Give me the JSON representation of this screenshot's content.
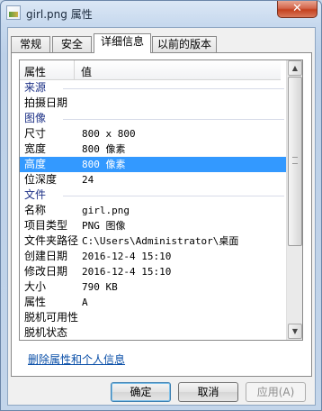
{
  "window": {
    "title": "girl.png 属性",
    "close_glyph": "✕"
  },
  "tabs": [
    {
      "label": "常规"
    },
    {
      "label": "安全"
    },
    {
      "label": "详细信息"
    },
    {
      "label": "以前的版本"
    }
  ],
  "columns": {
    "property": "属性",
    "value": "值"
  },
  "properties": [
    {
      "type": "group",
      "key": "来源",
      "value": ""
    },
    {
      "type": "item",
      "key": "拍摄日期",
      "value": ""
    },
    {
      "type": "group",
      "key": "图像",
      "value": ""
    },
    {
      "type": "item",
      "key": "尺寸",
      "value": "800 x 800"
    },
    {
      "type": "item",
      "key": "宽度",
      "value": "800 像素"
    },
    {
      "type": "item",
      "key": "高度",
      "value": "800 像素",
      "selected": true
    },
    {
      "type": "item",
      "key": "位深度",
      "value": "24"
    },
    {
      "type": "group",
      "key": "文件",
      "value": ""
    },
    {
      "type": "item",
      "key": "名称",
      "value": "girl.png"
    },
    {
      "type": "item",
      "key": "项目类型",
      "value": "PNG 图像"
    },
    {
      "type": "item",
      "key": "文件夹路径",
      "value": "C:\\Users\\Administrator\\桌面"
    },
    {
      "type": "item",
      "key": "创建日期",
      "value": "2016-12-4 15:10"
    },
    {
      "type": "item",
      "key": "修改日期",
      "value": "2016-12-4 15:10"
    },
    {
      "type": "item",
      "key": "大小",
      "value": "790 KB"
    },
    {
      "type": "item",
      "key": "属性",
      "value": "A"
    },
    {
      "type": "item",
      "key": "脱机可用性",
      "value": ""
    },
    {
      "type": "item",
      "key": "脱机状态",
      "value": ""
    }
  ],
  "scrollbar": {
    "up_glyph": "▲",
    "down_glyph": "▼"
  },
  "remove_link": "删除属性和个人信息",
  "buttons": {
    "ok": "确定",
    "cancel": "取消",
    "apply": "应用(A)"
  },
  "colors": {
    "selection": "#3399ff",
    "group_header": "#1e3287",
    "link": "#0a4fa8"
  }
}
